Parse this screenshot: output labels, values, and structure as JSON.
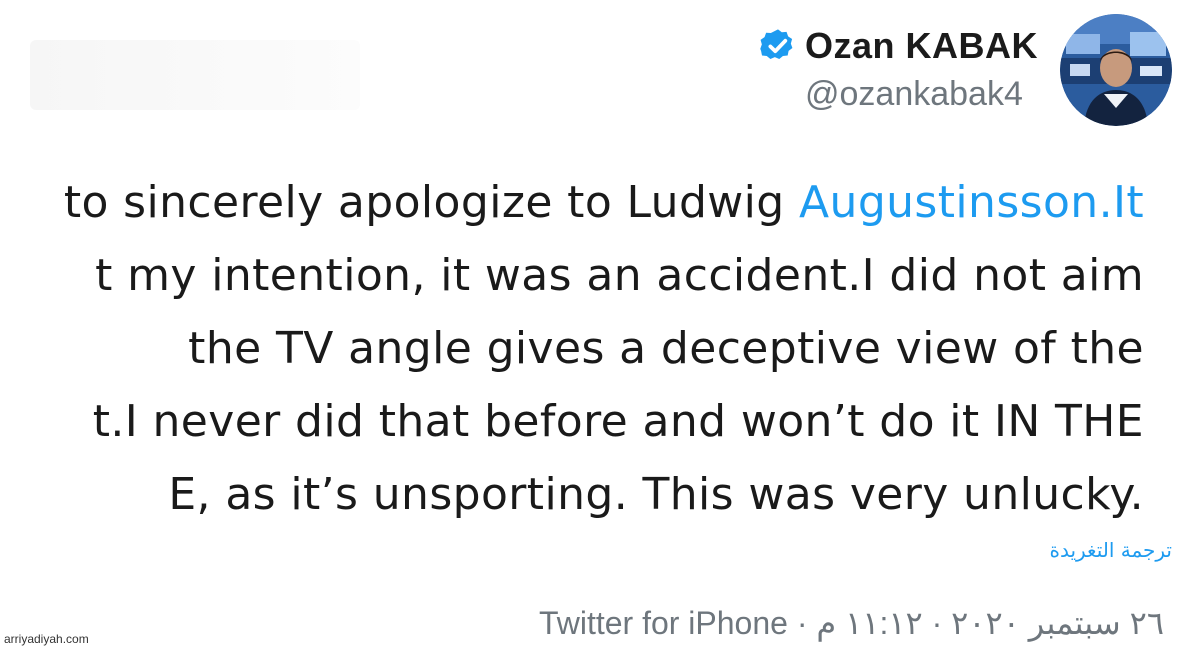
{
  "author": {
    "display_name": "Ozan KABAK",
    "handle": "@ozankabak4",
    "verified": true,
    "avatar_icon": "profile-photo",
    "verified_color": "#1d9bf0"
  },
  "tweet": {
    "lines": [
      {
        "text": "to sincerely apologize to Ludwig ",
        "mention": "Augustinsson.It"
      },
      {
        "text": "t my intention, it was an accident.I did not aim",
        "mention": ""
      },
      {
        "text": " the TV angle gives a deceptive view of the",
        "mention": ""
      },
      {
        "text": "t.I never did that before and won’t do it IN THE",
        "mention": ""
      },
      {
        "text": "E, as it’s unsporting. This was very unlucky.",
        "mention": ""
      }
    ],
    "translate_label": "ترجمة التغريدة",
    "time": "١١:١٢ م",
    "date": "٢٦ سبتمبر ٢٠٢٠",
    "separator": " · ",
    "source": "Twitter for iPhone"
  },
  "watermark": "arriyadiyah.com",
  "colors": {
    "accent": "#1d9bf0",
    "text": "#1a1a1a",
    "muted": "#6e767d"
  }
}
